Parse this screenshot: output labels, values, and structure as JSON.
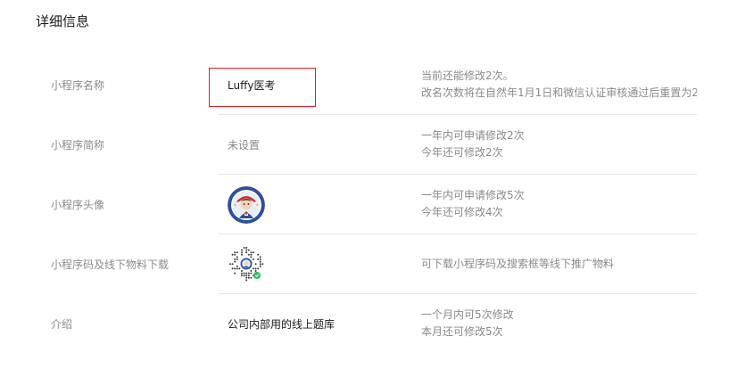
{
  "section_title": "详细信息",
  "rows": [
    {
      "label": "小程序名称",
      "value": "Luffy医考",
      "note_line1": "当前还能修改2次。",
      "note_line2": "改名次数将在自然年1月1日和微信认证审核通过后重置为2"
    },
    {
      "label": "小程序简称",
      "value": "未设置",
      "note_line1": "一年内可申请修改2次",
      "note_line2": "今年还可修改2次"
    },
    {
      "label": "小程序头像",
      "value_icon": "mini-program-avatar",
      "note_line1": "一年内可申请修改5次",
      "note_line2": "今年还可修改4次"
    },
    {
      "label": "小程序码及线下物料下载",
      "value_icon": "mini-program-code",
      "note_line1": "可下载小程序码及搜索框等线下推广物料"
    },
    {
      "label": "介绍",
      "value": "公司内部用的线上题库",
      "note_line1": "一个月内可5次修改",
      "note_line2": "本月还可修改5次"
    }
  ],
  "colors": {
    "highlight_border": "#e02020",
    "label_text": "#8a8a8a",
    "value_text": "#1a1a1a",
    "divider": "#e7e7e7",
    "qrcode_badge": "#2bbd5a"
  }
}
